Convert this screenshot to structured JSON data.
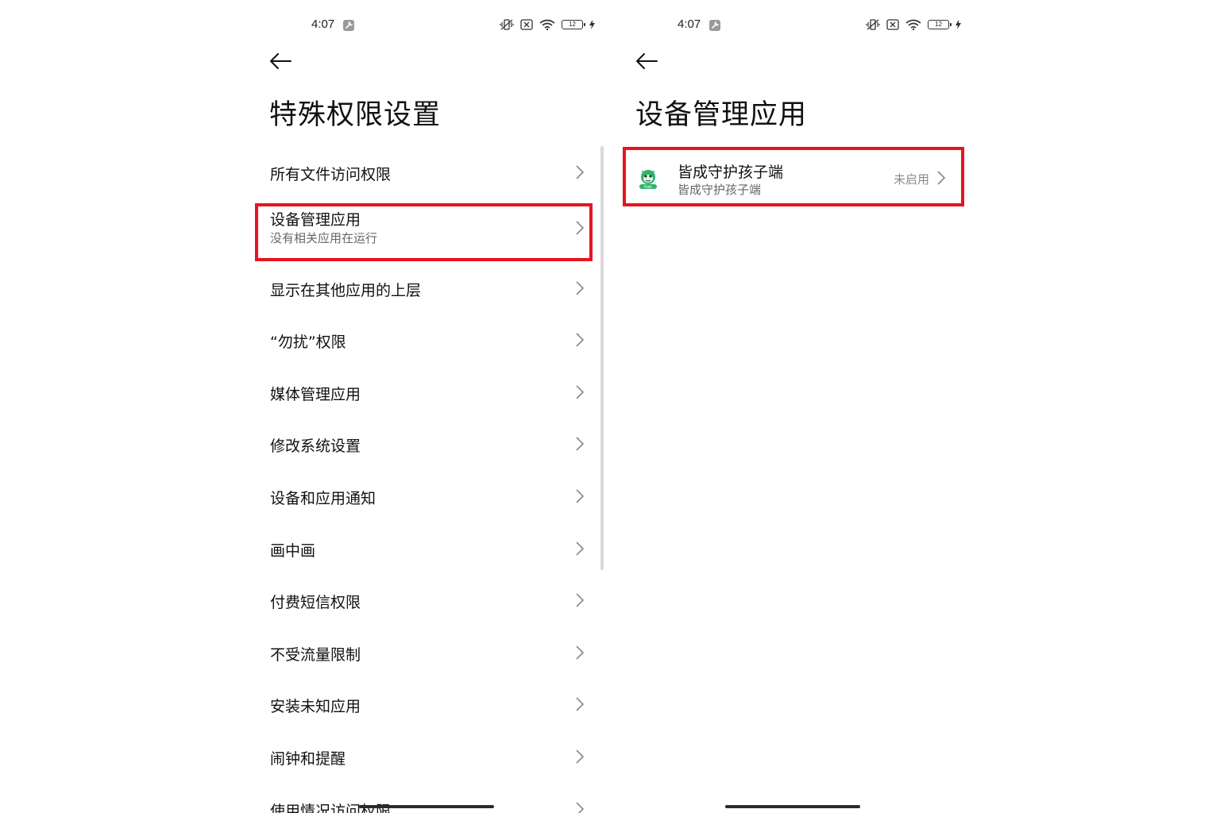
{
  "left_screen": {
    "status_bar": {
      "time": "4:07",
      "battery": "12"
    },
    "title": "特殊权限设置",
    "items": [
      {
        "label": "所有文件访问权限",
        "sub": ""
      },
      {
        "label": "设备管理应用",
        "sub": "没有相关应用在运行"
      },
      {
        "label": "显示在其他应用的上层",
        "sub": ""
      },
      {
        "label": "“勿扰”权限",
        "sub": ""
      },
      {
        "label": "媒体管理应用",
        "sub": ""
      },
      {
        "label": "修改系统设置",
        "sub": ""
      },
      {
        "label": "设备和应用通知",
        "sub": ""
      },
      {
        "label": "画中画",
        "sub": ""
      },
      {
        "label": "付费短信权限",
        "sub": ""
      },
      {
        "label": "不受流量限制",
        "sub": ""
      },
      {
        "label": "安装未知应用",
        "sub": ""
      },
      {
        "label": "闹钟和提醒",
        "sub": ""
      },
      {
        "label": "使用情况访问权限",
        "sub": ""
      }
    ]
  },
  "right_screen": {
    "status_bar": {
      "time": "4:07",
      "battery": "12"
    },
    "title": "设备管理应用",
    "app": {
      "name": "皆成守护孩子端",
      "sub": "皆成守护孩子端",
      "status": "未启用",
      "icon": "kids-app-icon",
      "icon_badge": "Kids"
    }
  },
  "colors": {
    "highlight": "#e8131e",
    "app_green": "#2fb36c"
  }
}
